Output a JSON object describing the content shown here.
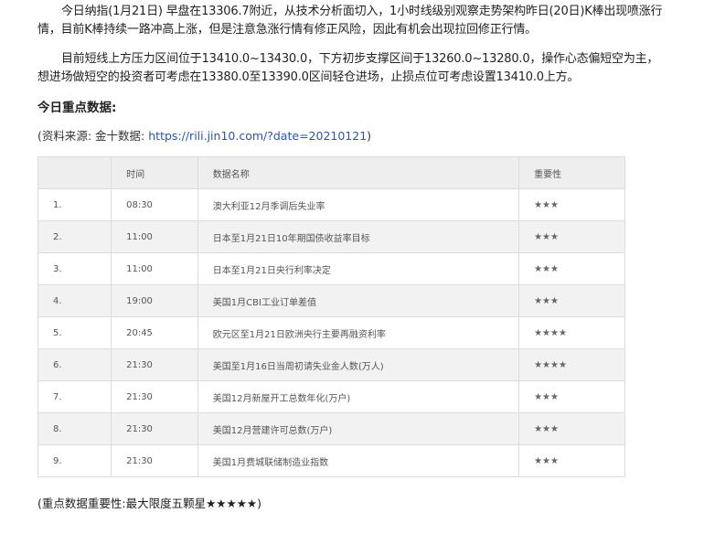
{
  "article": {
    "paragraph1": "今日纳指(1月21日) 早盘在13306.7附近，从技术分析面切入，1小时线级别观察走势架构昨日(20日)K棒出现喷涨行情，目前K棒持续一路冲高上涨，但是注意急涨行情有修正风险，因此有机会出现拉回修正行情。",
    "paragraph2": "目前短线上方压力区间位于13410.0~13430.0，下方初步支撑区间于13260.0~13280.0，操作心态偏短空为主，想进场做短空的投资者可考虑在13380.0至13390.0区间轻仓进场，止损点位可考虑设置13410.0上方。",
    "section_title": "今日重点数据:",
    "source_prefix": "(资料来源: 金十数据: ",
    "source_link": "https://rili.jin10.com/?date=20210121",
    "source_suffix": ")",
    "footnote": "(重点数据重要性:最大限度五颗星★★★★★)"
  },
  "table": {
    "headers": [
      "",
      "时间",
      "数据名称",
      "重要性"
    ],
    "rows": [
      {
        "idx": "1.",
        "time": "08:30",
        "name": "澳大利亚12月季调后失业率",
        "importance": "★★★"
      },
      {
        "idx": "2.",
        "time": "11:00",
        "name": "日本至1月21日10年期国债收益率目标",
        "importance": "★★★"
      },
      {
        "idx": "3.",
        "time": "11:00",
        "name": "日本至1月21日央行利率决定",
        "importance": "★★★"
      },
      {
        "idx": "4.",
        "time": "19:00",
        "name": "美国1月CBI工业订单差值",
        "importance": "★★★"
      },
      {
        "idx": "5.",
        "time": "20:45",
        "name": "欧元区至1月21日欧洲央行主要再融资利率",
        "importance": "★★★★"
      },
      {
        "idx": "6.",
        "time": "21:30",
        "name": "美国至1月16日当周初请失业金人数(万人)",
        "importance": "★★★★"
      },
      {
        "idx": "7.",
        "time": "21:30",
        "name": "美国12月新屋开工总数年化(万户)",
        "importance": "★★★"
      },
      {
        "idx": "8.",
        "time": "21:30",
        "name": "美国12月营建许可总数(万户)",
        "importance": "★★★"
      },
      {
        "idx": "9.",
        "time": "21:30",
        "name": "美国1月费城联储制造业指数",
        "importance": "★★★"
      }
    ]
  }
}
